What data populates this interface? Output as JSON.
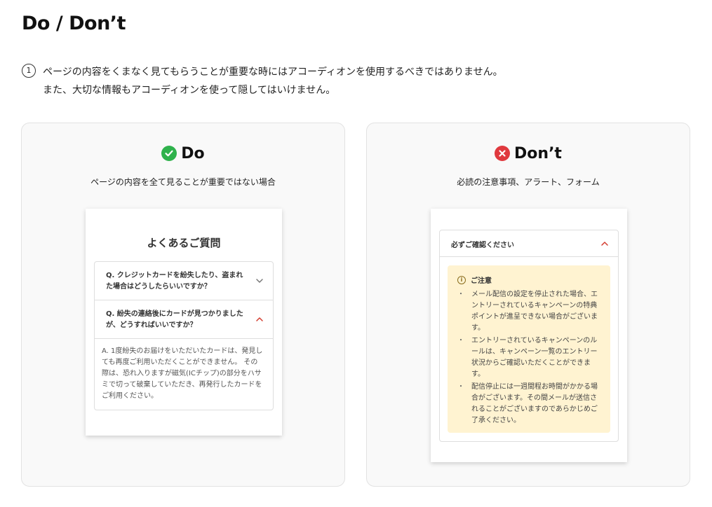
{
  "page": {
    "title": "Do / Don’t"
  },
  "note": {
    "number": "1",
    "line1": "ページの内容をくまなく見てもらうことが重要な時にはアコーディオンを使用するべきではありません。",
    "line2": "また、大切な情報もアコーディオンを使って隠してはいけません。"
  },
  "do_panel": {
    "heading": "Do",
    "subtitle": "ページの内容を全て見ることが重要ではない場合",
    "icon": "check-circle-icon",
    "color": "#2fb24c",
    "faq": {
      "title": "よくあるご質問",
      "q1": "Q. クレジットカードを紛失したり、盗まれた場合はどうしたらいいですか？",
      "q2": "Q. 紛失の連絡後にカードが見つかりましたが、どうすればいいですか？",
      "a2": "A. 1度紛失のお届けをいただいたカードは、発見しても再度ご利用いただくことができません。 その際は、恐れ入りますが磁気(ICチップ)の部分をハサミで切って破棄していただき、再発行したカードをご利用ください。"
    }
  },
  "dont_panel": {
    "heading": "Don’t",
    "subtitle": "必読の注意事項、アラート、フォーム",
    "icon": "x-circle-icon",
    "color": "#e0393e",
    "accordion": {
      "title": "必ずご確認ください",
      "alert_title": "ご注意",
      "items": [
        "メール配信の設定を停止された場合、エントリーされているキャンペーンの特典ポイントが進呈できない場合がございます。",
        "エントリーされているキャンペーンのルールは、キャンペーン一覧のエントリー状況からご確認いただくことができます。",
        "配信停止には一週間程お時間がかかる場合がございます。その間メールが送信されることがございますのであらかじめご了承ください。"
      ]
    }
  },
  "colors": {
    "chevron_open": "#d33c2f",
    "chevron_closed": "#777777",
    "alert_bg": "#fff3d1"
  }
}
